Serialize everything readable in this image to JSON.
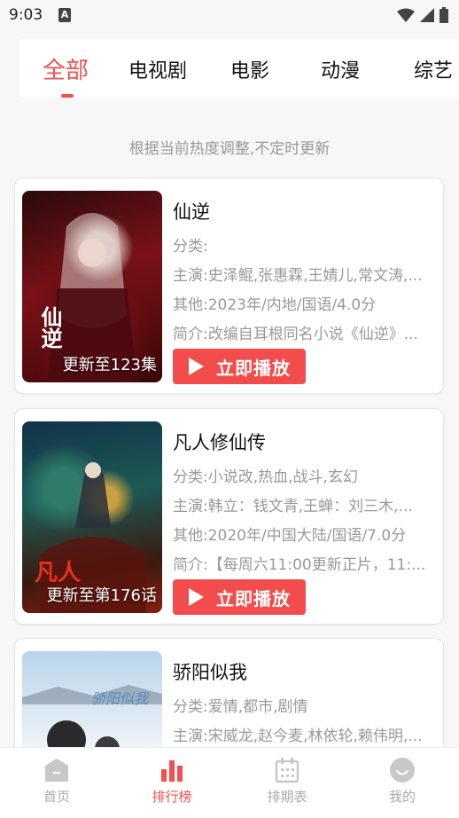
{
  "status": {
    "time": "9:03",
    "a_badge": "A"
  },
  "tabs": [
    {
      "label": "全部"
    },
    {
      "label": "电视剧"
    },
    {
      "label": "电影"
    },
    {
      "label": "动漫"
    },
    {
      "label": "综艺"
    }
  ],
  "subtitle": "根据当前热度调整,不定时更新",
  "play_label": "立即播放",
  "cards": [
    {
      "title": "仙逆",
      "category": "分类:",
      "cast": "主演:史泽鲲,张惠霖,王婧儿,常文涛,...",
      "other": "其他:2023年/内地/国语/4.0分",
      "intro": "简介:改编自耳根同名小说《仙逆》...",
      "caption": "更新至123集",
      "poster_text": "仙逆"
    },
    {
      "title": "凡人修仙传",
      "category": "分类:小说改,热血,战斗,玄幻",
      "cast": "主演:韩立：钱文青,王蝉：刘三木,...",
      "other": "其他:2020年/中国大陆/国语/7.0分",
      "intro": "简介:【每周六11:00更新正片，11:...",
      "caption": "更新至第176话",
      "poster_text": "凡人"
    },
    {
      "title": "骄阳似我",
      "category": "分类:爱情,都市,剧情",
      "cast": "主演:宋威龙,赵今麦,林依轮,赖伟明,...",
      "poster_text": "骄阳似我"
    }
  ],
  "nav": [
    {
      "label": "首页"
    },
    {
      "label": "排行榜"
    },
    {
      "label": "排期表"
    },
    {
      "label": "我的"
    }
  ],
  "colors": {
    "accent": "#f05050",
    "button": "#f24c4c",
    "muted": "#999999"
  }
}
